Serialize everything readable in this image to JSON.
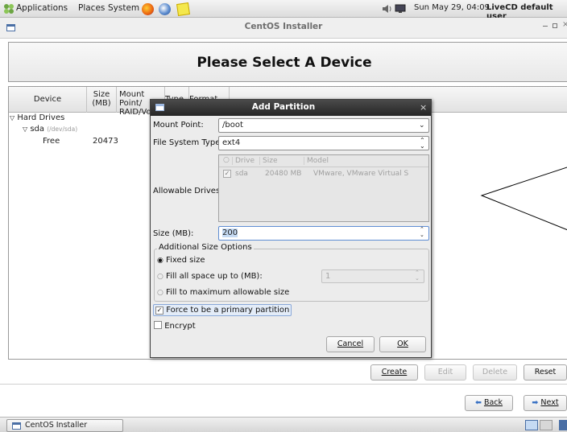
{
  "top_panel": {
    "menus": [
      "Applications",
      "Places",
      "System"
    ],
    "clock": "Sun May 29, 04:09",
    "user": "LiveCD default user",
    "icons": [
      "firefox-icon",
      "network-icon",
      "notes-icon",
      "volume-icon",
      "display-icon"
    ]
  },
  "window": {
    "title": "CentOS Installer",
    "controls": [
      "minimize-icon",
      "maximize-icon",
      "close-icon"
    ]
  },
  "banner": {
    "heading": "Please Select A Device"
  },
  "table": {
    "headers": {
      "device": "Device",
      "size_a": "Size",
      "size_b": "(MB)",
      "mount_a": "Mount Point/",
      "mount_b": "RAID/Vo",
      "type": "Type",
      "format": "Format"
    },
    "tree": {
      "group": "Hard Drives",
      "disk": "sda",
      "disk_path": "(/dev/sda)",
      "free_label": "Free",
      "free_size": "20473"
    }
  },
  "actions": {
    "create": "Create",
    "edit": "Edit",
    "delete": "Delete",
    "reset": "Reset"
  },
  "nav": {
    "back": "Back",
    "next": "Next"
  },
  "taskbar": {
    "task": "CentOS Installer"
  },
  "dialog": {
    "title": "Add Partition",
    "mount_label": "Mount Point:",
    "mount_value": "/boot",
    "fs_label": "File System Type:",
    "fs_value": "ext4",
    "drives_label": "Allowable Drives:",
    "drives_headers": [
      "Drive",
      "Size",
      "Model"
    ],
    "drives_row": {
      "checked": true,
      "drive": "sda",
      "size": "20480 MB",
      "model": "VMware, VMware Virtual S"
    },
    "size_label": "Size (MB):",
    "size_value": "200",
    "options_legend": "Additional Size Options",
    "opt_fixed": "Fixed size",
    "opt_fill_upto": "Fill all space up to (MB):",
    "opt_fill_upto_value": "1",
    "opt_fill_max": "Fill to maximum allowable size",
    "primary_label": "Force to be a primary partition",
    "primary_checked": true,
    "encrypt_label": "Encrypt",
    "encrypt_checked": false,
    "cancel": "Cancel",
    "ok": "OK"
  },
  "colors": {
    "dialog_title_bg": "#2f2f2f",
    "selection_bg": "#c5daf3",
    "accent_blue": "#3a72c4"
  }
}
